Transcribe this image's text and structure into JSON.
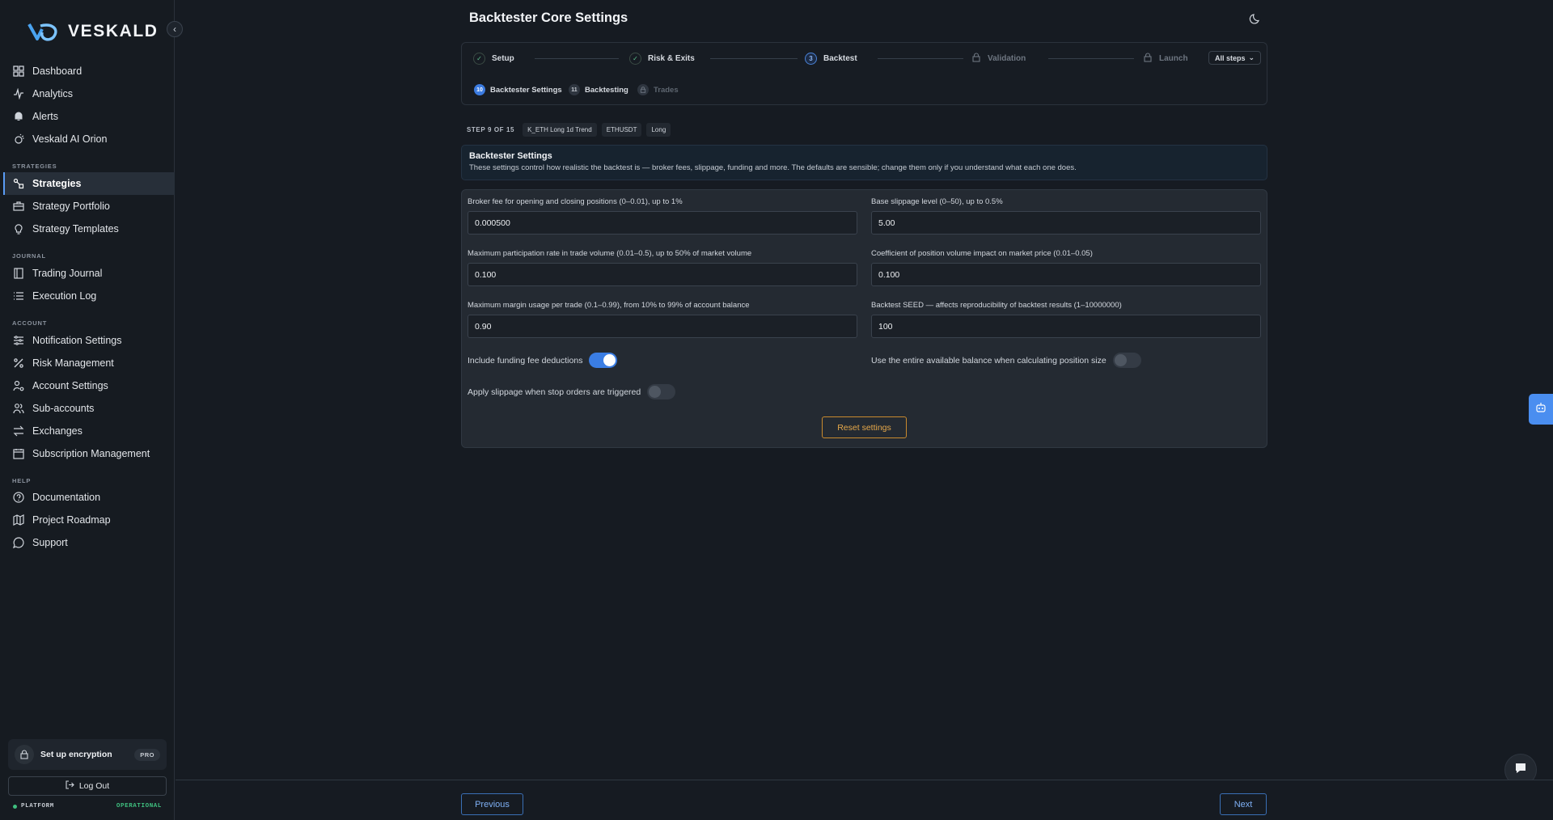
{
  "brand": {
    "name": "VESKALD"
  },
  "sidebar": {
    "sections": {
      "strategies": "STRATEGIES",
      "journal": "JOURNAL",
      "account": "ACCOUNT",
      "help": "HELP"
    },
    "items": [
      {
        "label": "Dashboard",
        "icon": "grid-icon"
      },
      {
        "label": "Analytics",
        "icon": "activity-icon"
      },
      {
        "label": "Alerts",
        "icon": "bell-icon"
      },
      {
        "label": "Veskald AI Orion",
        "icon": "ai-icon"
      },
      {
        "label": "Strategies",
        "icon": "strategies-icon"
      },
      {
        "label": "Strategy Portfolio",
        "icon": "briefcase-icon"
      },
      {
        "label": "Strategy Templates",
        "icon": "lightbulb-icon"
      },
      {
        "label": "Trading Journal",
        "icon": "book-icon"
      },
      {
        "label": "Execution Log",
        "icon": "list-icon"
      },
      {
        "label": "Notification Settings",
        "icon": "sliders-icon"
      },
      {
        "label": "Risk Management",
        "icon": "percent-icon"
      },
      {
        "label": "Account Settings",
        "icon": "user-gear-icon"
      },
      {
        "label": "Sub-accounts",
        "icon": "users-icon"
      },
      {
        "label": "Exchanges",
        "icon": "swap-icon"
      },
      {
        "label": "Subscription Management",
        "icon": "calendar-icon"
      },
      {
        "label": "Documentation",
        "icon": "help-circle-icon"
      },
      {
        "label": "Project Roadmap",
        "icon": "map-icon"
      },
      {
        "label": "Support",
        "icon": "message-circle-icon"
      }
    ],
    "encryption": {
      "label": "Set up encryption",
      "badge": "PRO"
    },
    "logout": "Log Out",
    "platform": {
      "label": "PLATFORM",
      "status": "OPERATIONAL"
    }
  },
  "page": {
    "title": "Backtester Core Settings"
  },
  "stepper": {
    "steps": [
      {
        "label": "Setup",
        "state": "done"
      },
      {
        "label": "Risk & Exits",
        "state": "done"
      },
      {
        "label": "Backtest",
        "state": "current",
        "number": "3"
      },
      {
        "label": "Validation",
        "state": "locked"
      },
      {
        "label": "Launch",
        "state": "locked"
      }
    ],
    "all_steps": "All steps",
    "substeps": [
      {
        "number": "10",
        "label": "Backtester Settings",
        "state": "current"
      },
      {
        "number": "11",
        "label": "Backtesting",
        "state": "normal"
      },
      {
        "label": "Trades",
        "state": "locked"
      }
    ]
  },
  "meta": {
    "step_counter": "STEP 9 OF 15",
    "chips": [
      "K_ETH Long 1d Trend",
      "ETHUSDT",
      "Long"
    ]
  },
  "info": {
    "title": "Backtester Settings",
    "text": "These settings control how realistic the backtest is — broker fees, slippage, funding and more. The defaults are sensible; change them only if you understand what each one does."
  },
  "fields": {
    "broker_fee": {
      "label": "Broker fee for opening and closing positions (0–0.01), up to 1%",
      "value": "0.000500"
    },
    "base_slippage": {
      "label": "Base slippage level (0–50), up to 0.5%",
      "value": "5.00"
    },
    "participation_rate": {
      "label": "Maximum participation rate in trade volume (0.01–0.5), up to 50% of market volume",
      "value": "0.100"
    },
    "impact_coef": {
      "label": "Coefficient of position volume impact on market price (0.01–0.05)",
      "value": "0.100"
    },
    "margin_usage": {
      "label": "Maximum margin usage per trade (0.1–0.99), from 10% to 99% of account balance",
      "value": "0.90"
    },
    "seed": {
      "label": "Backtest SEED — affects reproducibility of backtest results (1–10000000)",
      "value": "100"
    }
  },
  "toggles": {
    "funding": {
      "label": "Include funding fee deductions",
      "on": true
    },
    "entire_balance": {
      "label": "Use the entire available balance when calculating position size",
      "on": false
    },
    "stop_slippage": {
      "label": "Apply slippage when stop orders are triggered",
      "on": false
    }
  },
  "buttons": {
    "reset": "Reset settings",
    "previous": "Previous",
    "next": "Next"
  },
  "colors": {
    "accent": "#3a7de4",
    "warning": "#e6a84a",
    "success": "#3fbf7f"
  }
}
